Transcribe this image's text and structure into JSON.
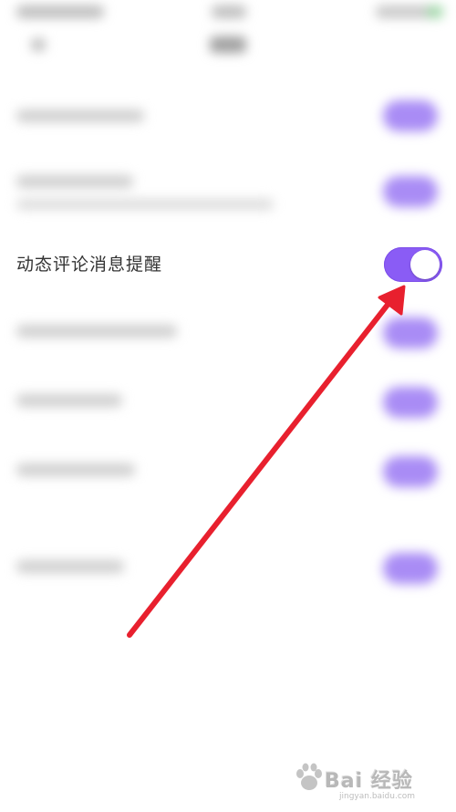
{
  "setting": {
    "label": "动态评论消息提醒",
    "enabled": true
  },
  "colors": {
    "toggle_on": "#8a5cf5",
    "arrow": "#e8202e",
    "label_text": "#333333"
  },
  "watermark": {
    "brand": "Bai 经验",
    "url": "jingyan.baidu.com"
  }
}
